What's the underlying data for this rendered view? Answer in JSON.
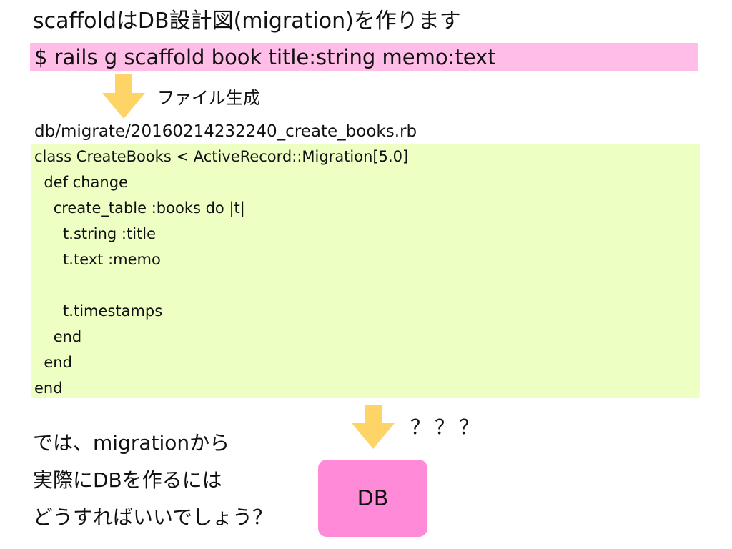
{
  "title": "scaffoldはDB設計図(migration)を作ります",
  "command": "$ rails g scaffold book title:string memo:text",
  "file_label": "ファイル生成",
  "file_path": "db/migrate/20160214232240_create_books.rb",
  "code": [
    "class CreateBooks < ActiveRecord::Migration[5.0]",
    "  def change",
    "    create_table :books do |t|",
    "      t.string :title",
    "      t.text :memo",
    "",
    "      t.timestamps",
    "    end",
    "  end",
    "end"
  ],
  "question": [
    "では、migrationから",
    "実際にDBを作るには",
    "どうすればいいでしょう？"
  ],
  "question_marks": "？？？",
  "db_label": "DB",
  "icons": {
    "arrow_1": "arrow-down-icon",
    "arrow_2": "arrow-down-icon"
  },
  "colors": {
    "command_bg": "#ffbde8",
    "code_bg": "#eeffc4",
    "arrow": "#ffd466",
    "db_box": "#ff8ad8"
  }
}
